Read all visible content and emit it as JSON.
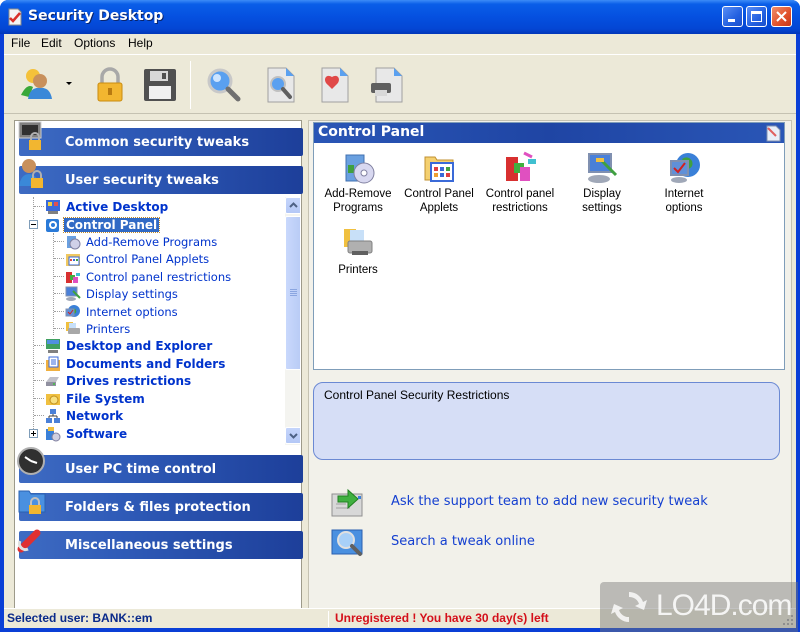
{
  "window": {
    "title": "Security Desktop",
    "controls": {
      "minimize": "minimize-icon",
      "maximize": "maximize-icon",
      "close": "close-icon"
    }
  },
  "menu": [
    "File",
    "Edit",
    "Options",
    "Help"
  ],
  "toolbar": {
    "buttons": [
      {
        "name": "users",
        "icon": "users-icon",
        "has_dropdown": true
      },
      {
        "name": "lock",
        "icon": "padlock-icon"
      },
      {
        "name": "save",
        "icon": "floppy-disk-icon"
      },
      {
        "name": "search",
        "icon": "magnifier-icon"
      },
      {
        "name": "find-document",
        "icon": "document-search-icon"
      },
      {
        "name": "favorite-document",
        "icon": "document-heart-icon"
      },
      {
        "name": "print",
        "icon": "document-printer-icon"
      }
    ]
  },
  "sidebar": {
    "categories": [
      {
        "label": "Common security tweaks",
        "icon": "monitor-lock-icon"
      },
      {
        "label": "User security tweaks",
        "icon": "user-lock-icon",
        "expanded": true
      },
      {
        "label": "User PC time control",
        "icon": "clock-icon"
      },
      {
        "label": "Folders & files protection",
        "icon": "folder-lock-icon"
      },
      {
        "label": "Miscellaneous settings",
        "icon": "wrench-icon"
      }
    ],
    "tree": [
      {
        "label": "Active Desktop",
        "level": 0,
        "icon": "active-desktop-icon"
      },
      {
        "label": "Control Panel",
        "level": 0,
        "icon": "control-panel-icon",
        "selected": true,
        "expanded": true
      },
      {
        "label": "Add-Remove Programs",
        "level": 1,
        "icon": "add-remove-programs-icon"
      },
      {
        "label": "Control Panel Applets",
        "level": 1,
        "icon": "applets-icon"
      },
      {
        "label": "Control panel restrictions",
        "level": 1,
        "icon": "restrictions-icon"
      },
      {
        "label": "Display settings",
        "level": 1,
        "icon": "display-icon"
      },
      {
        "label": "Internet options",
        "level": 1,
        "icon": "internet-icon"
      },
      {
        "label": "Printers",
        "level": 1,
        "icon": "printer-icon"
      },
      {
        "label": "Desktop and Explorer",
        "level": 0,
        "icon": "desktop-explorer-icon"
      },
      {
        "label": "Documents and Folders",
        "level": 0,
        "icon": "documents-folders-icon"
      },
      {
        "label": "Drives restrictions",
        "level": 0,
        "icon": "drive-icon"
      },
      {
        "label": "File System",
        "level": 0,
        "icon": "file-system-icon"
      },
      {
        "label": "Network",
        "level": 0,
        "icon": "network-icon"
      },
      {
        "label": "Software",
        "level": 0,
        "icon": "software-icon",
        "collapsed": true
      }
    ]
  },
  "panel": {
    "title": "Control Panel",
    "items": [
      {
        "label": "Add-Remove Programs",
        "line1": "Add-Remove",
        "line2": "Programs",
        "icon": "add-remove-programs-icon"
      },
      {
        "label": "Control Panel Applets",
        "line1": "Control Panel",
        "line2": "Applets",
        "icon": "applets-icon"
      },
      {
        "label": "Control panel restrictions",
        "line1": "Control panel",
        "line2": "restrictions",
        "icon": "restrictions-icon"
      },
      {
        "label": "Display settings",
        "line1": "Display",
        "line2": "settings",
        "icon": "display-icon"
      },
      {
        "label": "Internet options",
        "line1": "Internet",
        "line2": "options",
        "icon": "internet-icon"
      },
      {
        "label": "Printers",
        "line1": "Printers",
        "line2": "",
        "icon": "printer-icon"
      }
    ],
    "description": "Control Panel Security Restrictions"
  },
  "links": [
    {
      "label": "Ask the support team to add new security tweak",
      "icon": "send-request-icon"
    },
    {
      "label": "Search a tweak online",
      "icon": "search-online-icon"
    }
  ],
  "status": {
    "user": "Selected user: BANK::em",
    "registration": "Unregistered ! You have 30 day(s) left"
  },
  "watermark": "LO4D.com",
  "colors": {
    "titlebar": "#0550e0",
    "category_header": "#2f5bb8",
    "tree_link": "#0033cc",
    "selection": "#316ac5",
    "desc_box": "#d6def6",
    "link": "#1540d0",
    "status_user": "#0a2a8a",
    "status_warning": "#d4101a"
  }
}
